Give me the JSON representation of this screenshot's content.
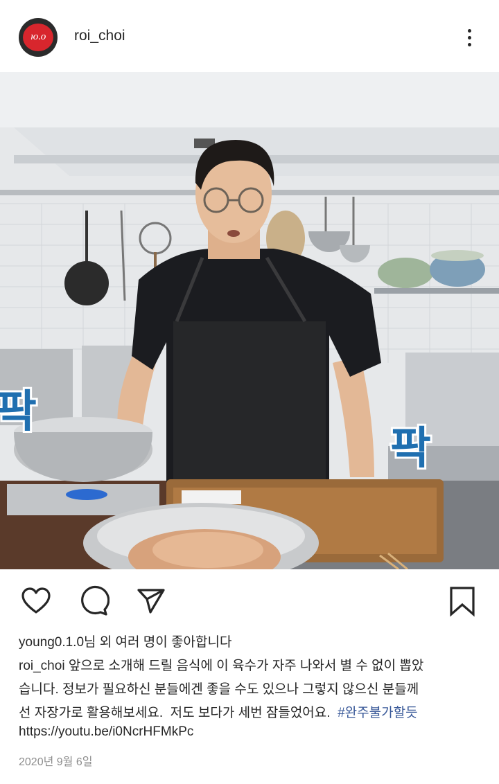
{
  "header": {
    "avatar_text": "ю.о",
    "username": "roi_choi"
  },
  "photo": {
    "overlay_text_left": "팍",
    "overlay_text_right": "팍"
  },
  "actions": {
    "like_icon": "heart-icon",
    "comment_icon": "comment-icon",
    "share_icon": "paper-plane-icon",
    "save_icon": "bookmark-icon"
  },
  "likes": {
    "user": "young0.1.0",
    "text": "님 외 여러 명이 좋아합니다"
  },
  "caption": {
    "username": "roi_choi",
    "line1": " 앞으로 소개해 드릴 음식에 이 육수가 자주 나와서 별 수 없이 뽑았",
    "line2": "습니다. 정보가 필요하신 분들에겐 좋을 수도 있으나 그렇지 않으신 분들께",
    "line3": "선 자장가로 활용해보세요.  저도 보다가 세번 잠들었어요.  ",
    "hashtag": "#완주불가할듯",
    "link": "https://youtu.be/i0NcrHFMkPc"
  },
  "date": "2020년 9월 6일",
  "colors": {
    "text": "#262626",
    "muted": "#8e8e8e",
    "hashtag": "#385898",
    "overlay_text": "#1f6fb0"
  }
}
